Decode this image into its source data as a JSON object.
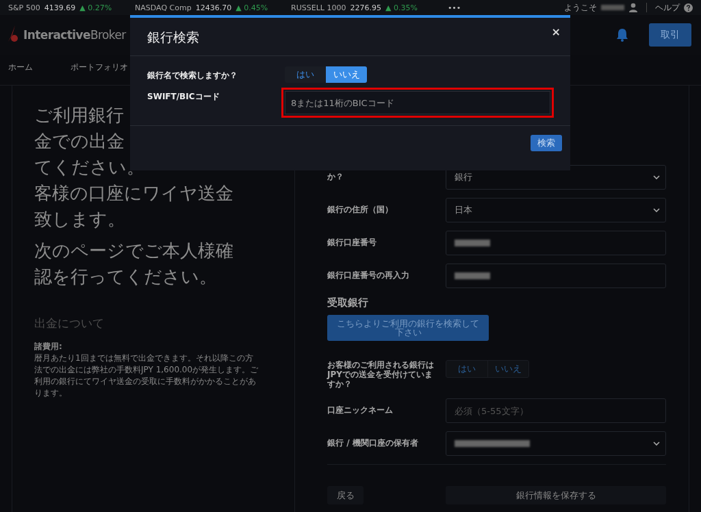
{
  "ticker": [
    {
      "name": "S&P 500",
      "value": "4139.69",
      "change": "▲ 0.27%"
    },
    {
      "name": "NASDAQ Comp",
      "value": "12436.70",
      "change": "▲ 0.45%"
    },
    {
      "name": "RUSSELL 1000",
      "value": "2276.95",
      "change": "▲ 0.35%"
    }
  ],
  "ticker_more": "•••",
  "welcome": "ようこそ",
  "help": "ヘルプ",
  "logo": "**Interactive**Broker",
  "trade_button": "取引",
  "nav": [
    "ホーム",
    "ポートフォリオ"
  ],
  "intro": {
    "lines": [
      "ご利用銀行",
      "金での出金",
      "てください。",
      "客様の口座にワイヤ送金",
      "致します。"
    ],
    "second": "次のページでご本人様確認を行ってください。",
    "heading": "出金について",
    "fees_label": "諸費用:",
    "fees_text": "暦月あたり1回までは無料で出金できます。それ以降この方法での出金には弊社の手数料JPY 1,600.00が発生します。ご利用の銀行にてワイヤ送金の受取に手数料がかかることがあります。"
  },
  "form": {
    "rows": [
      {
        "kind": "select",
        "label": "か？",
        "value": "銀行"
      },
      {
        "kind": "select",
        "label": "銀行の住所（国）",
        "value": "日本"
      },
      {
        "kind": "redacted",
        "label": "銀行口座番号"
      },
      {
        "kind": "redacted",
        "label": "銀行口座番号の再入力"
      }
    ],
    "section": "受取銀行",
    "search_button": "こちらよりご利用の銀行を検索して下さい",
    "jpy_question": "お客様のご利用される銀行はJPYでの送金を受付けていますか？",
    "jpy_options": [
      {
        "label": "はい",
        "selected": false
      },
      {
        "label": "いいえ",
        "selected": false
      }
    ],
    "nickname_label": "口座ニックネーム",
    "nickname_placeholder": "必須（5-55文字）",
    "holder_label": "銀行 / 機関口座の保有者",
    "back": "戻る",
    "save": "銀行情報を保存する"
  },
  "modal": {
    "title": "銀行検索",
    "close": "×",
    "question": "銀行名で検索しますか？",
    "options": [
      {
        "label": "はい",
        "selected": false
      },
      {
        "label": "いいえ",
        "selected": true
      }
    ],
    "code_label": "SWIFT/BICコード",
    "code_placeholder": "8または11桁のBICコード",
    "code_highlighted": true,
    "search": "検索"
  }
}
